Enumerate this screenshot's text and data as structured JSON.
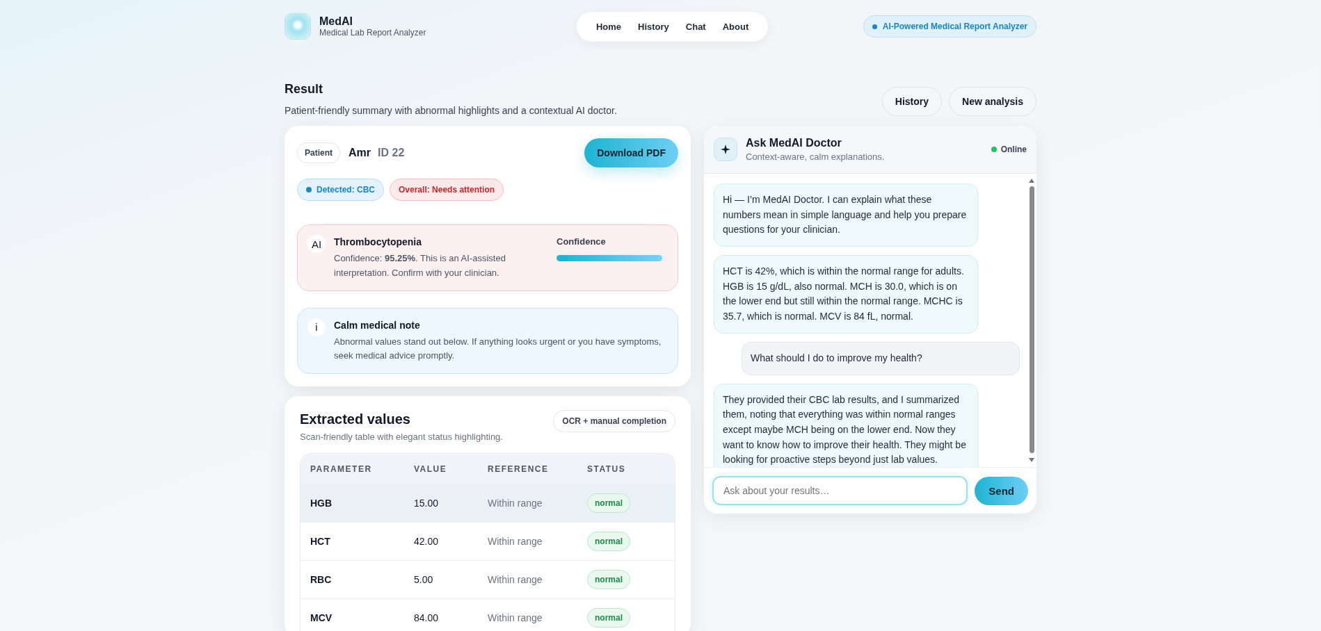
{
  "brand": {
    "name": "MedAI",
    "tagline": "Medical Lab Report Analyzer"
  },
  "nav": [
    {
      "label": "Home"
    },
    {
      "label": "History"
    },
    {
      "label": "Chat"
    },
    {
      "label": "About"
    }
  ],
  "header_badge": "AI-Powered Medical Report Analyzer",
  "page": {
    "title": "Result",
    "subtitle": "Patient-friendly summary with abnormal highlights and a contextual AI doctor."
  },
  "actions": [
    "History",
    "New analysis"
  ],
  "patient": {
    "tag": "Patient",
    "name": "Amr",
    "id": "ID 22"
  },
  "download_button": "Download PDF",
  "chips": [
    {
      "label": "Detected: CBC",
      "kind": "info"
    },
    {
      "label": "Overall: Needs attention",
      "kind": "alert"
    }
  ],
  "diagnosis": {
    "icon_text": "AI",
    "title": "Thrombocytopenia",
    "text": "Confidence: **95.25%**. This is an AI-assisted interpretation. Confirm with your clinician.",
    "confidence_label": "Confidence",
    "level": 0.95
  },
  "note": {
    "icon_text": "i",
    "title": "Calm medical note",
    "text": "Abnormal values stand out below. If anything looks urgent or you have symptoms, seek medical advice promptly."
  },
  "extracted": {
    "title": "Extracted values",
    "subtitle": "Scan-friendly table with elegant status highlighting.",
    "badge": "OCR + manual completion",
    "columns": [
      "PARAMETER",
      "VALUE",
      "REFERENCE",
      "STATUS"
    ],
    "rows": [
      {
        "parameter": "HGB",
        "value": "15.00",
        "reference": "Within range",
        "status": "normal",
        "kind": "normal",
        "selected": true
      },
      {
        "parameter": "HCT",
        "value": "42.00",
        "reference": "Within range",
        "status": "normal",
        "kind": "normal",
        "selected": false
      },
      {
        "parameter": "RBC",
        "value": "5.00",
        "reference": "Within range",
        "status": "normal",
        "kind": "normal",
        "selected": false
      },
      {
        "parameter": "MCV",
        "value": "84.00",
        "reference": "Within range",
        "status": "normal",
        "kind": "normal",
        "selected": false
      }
    ]
  },
  "chat": {
    "title": "Ask MedAI Doctor",
    "subtitle": "Context-aware, calm explanations.",
    "status": "Online",
    "online": true,
    "messages": [
      {
        "kind": "assistant",
        "text": "Hi — I’m MedAI Doctor. I can explain what these numbers mean in simple language and help you prepare questions for your clinician."
      },
      {
        "kind": "assistant",
        "text": "HCT is 42%, which is within the normal range for adults. HGB is 15 g/dL, also normal. MCH is 30.0, which is on the lower end but still within the normal range. MCHC is 35.7, which is normal. MCV is 84 fL, normal."
      },
      {
        "kind": "user",
        "text": "What should I do to improve my health?"
      },
      {
        "kind": "assistant",
        "text": "They provided their CBC lab results, and I summarized them, noting that everything was within normal ranges except maybe MCH being on the lower end. Now they want to know how to improve their health. They might be looking for proactive steps beyond just lab values."
      }
    ],
    "input": {
      "placeholder": "Ask about your results…"
    },
    "send": "Send"
  }
}
